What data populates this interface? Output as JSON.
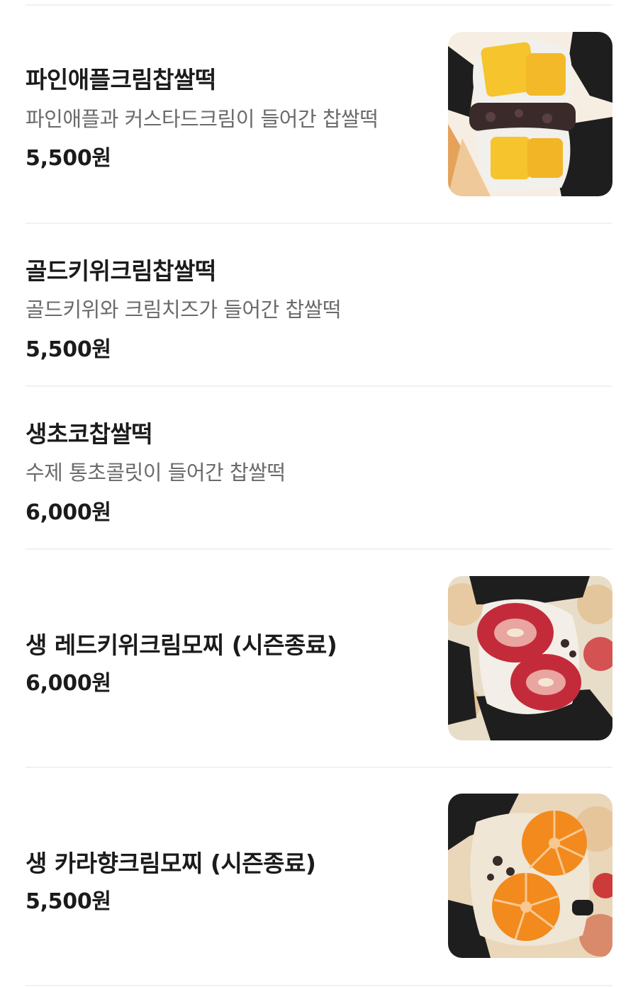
{
  "menu": {
    "items": [
      {
        "name": "파인애플크림찹쌀떡",
        "description": "파인애플과 커스타드크림이 들어간 찹쌀떡",
        "price": "5,500원",
        "photo_icon": "pineapple-mochi-photo"
      },
      {
        "name": "골드키위크림찹쌀떡",
        "description": "골드키위와 크림치즈가 들어간 찹쌀떡",
        "price": "5,500원"
      },
      {
        "name": "생초코찹쌀떡",
        "description": "수제 통초콜릿이 들어간 찹쌀떡",
        "price": "6,000원"
      },
      {
        "name": "생 레드키위크림모찌 (시즌종료)",
        "price": "6,000원",
        "photo_icon": "red-kiwi-mochi-photo"
      },
      {
        "name": "생 카라향크림모찌 (시즌종료)",
        "price": "5,500원",
        "photo_icon": "karahyang-mochi-photo"
      }
    ]
  }
}
